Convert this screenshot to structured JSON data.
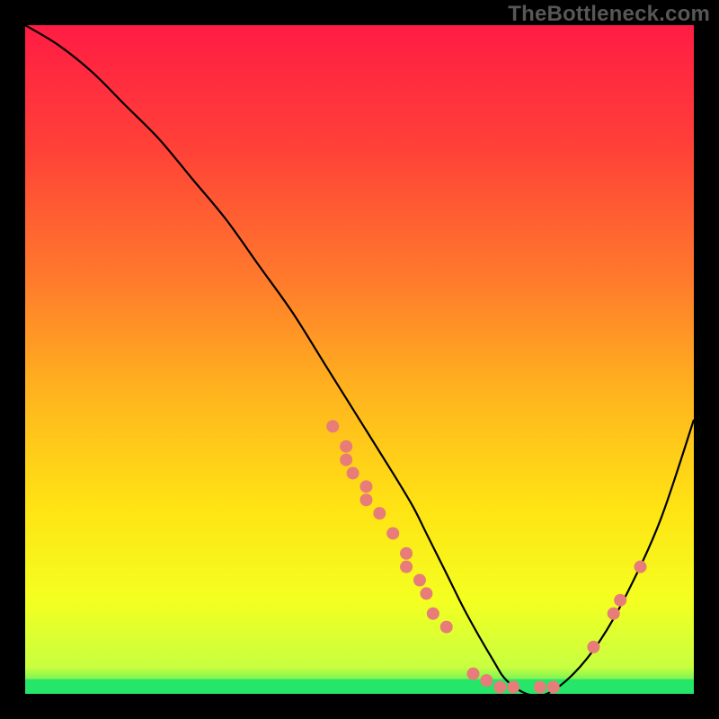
{
  "watermark": "TheBottleneck.com",
  "chart_data": {
    "type": "line",
    "title": "",
    "xlabel": "",
    "ylabel": "",
    "xlim": [
      0,
      100
    ],
    "ylim": [
      0,
      100
    ],
    "curve": {
      "name": "bottleneck-curve",
      "x": [
        0,
        5,
        10,
        15,
        20,
        25,
        30,
        35,
        40,
        45,
        50,
        55,
        58,
        60,
        63,
        66,
        70,
        72,
        75,
        78,
        82,
        86,
        90,
        95,
        100
      ],
      "y": [
        100,
        97,
        93,
        88,
        83,
        77,
        71,
        64,
        57,
        49,
        41,
        33,
        28,
        24,
        18,
        12,
        5,
        2,
        0,
        0,
        3,
        8,
        15,
        26,
        41
      ],
      "color": "#000000",
      "width": 2.2
    },
    "green_band": {
      "y_from": 0,
      "y_to": 2.2,
      "color": "#26e66a"
    },
    "scatter": {
      "color": "#e77c78",
      "radius": 7,
      "points": [
        {
          "x": 46,
          "y": 40
        },
        {
          "x": 48,
          "y": 37
        },
        {
          "x": 48,
          "y": 35
        },
        {
          "x": 49,
          "y": 33
        },
        {
          "x": 51,
          "y": 31
        },
        {
          "x": 51,
          "y": 29
        },
        {
          "x": 53,
          "y": 27
        },
        {
          "x": 55,
          "y": 24
        },
        {
          "x": 57,
          "y": 21
        },
        {
          "x": 57,
          "y": 19
        },
        {
          "x": 59,
          "y": 17
        },
        {
          "x": 60,
          "y": 15
        },
        {
          "x": 61,
          "y": 12
        },
        {
          "x": 63,
          "y": 10
        },
        {
          "x": 67,
          "y": 3
        },
        {
          "x": 69,
          "y": 2
        },
        {
          "x": 71,
          "y": 1
        },
        {
          "x": 73,
          "y": 1
        },
        {
          "x": 77,
          "y": 1
        },
        {
          "x": 79,
          "y": 1
        },
        {
          "x": 85,
          "y": 7
        },
        {
          "x": 88,
          "y": 12
        },
        {
          "x": 89,
          "y": 14
        },
        {
          "x": 92,
          "y": 19
        }
      ]
    },
    "background_gradient": {
      "stops": [
        {
          "offset": 0.0,
          "color": "#ff1c44"
        },
        {
          "offset": 0.18,
          "color": "#ff4038"
        },
        {
          "offset": 0.38,
          "color": "#ff7a2c"
        },
        {
          "offset": 0.55,
          "color": "#ffb41e"
        },
        {
          "offset": 0.72,
          "color": "#ffe314"
        },
        {
          "offset": 0.86,
          "color": "#f4ff20"
        },
        {
          "offset": 0.96,
          "color": "#c8ff40"
        },
        {
          "offset": 1.0,
          "color": "#26e66a"
        }
      ]
    }
  }
}
